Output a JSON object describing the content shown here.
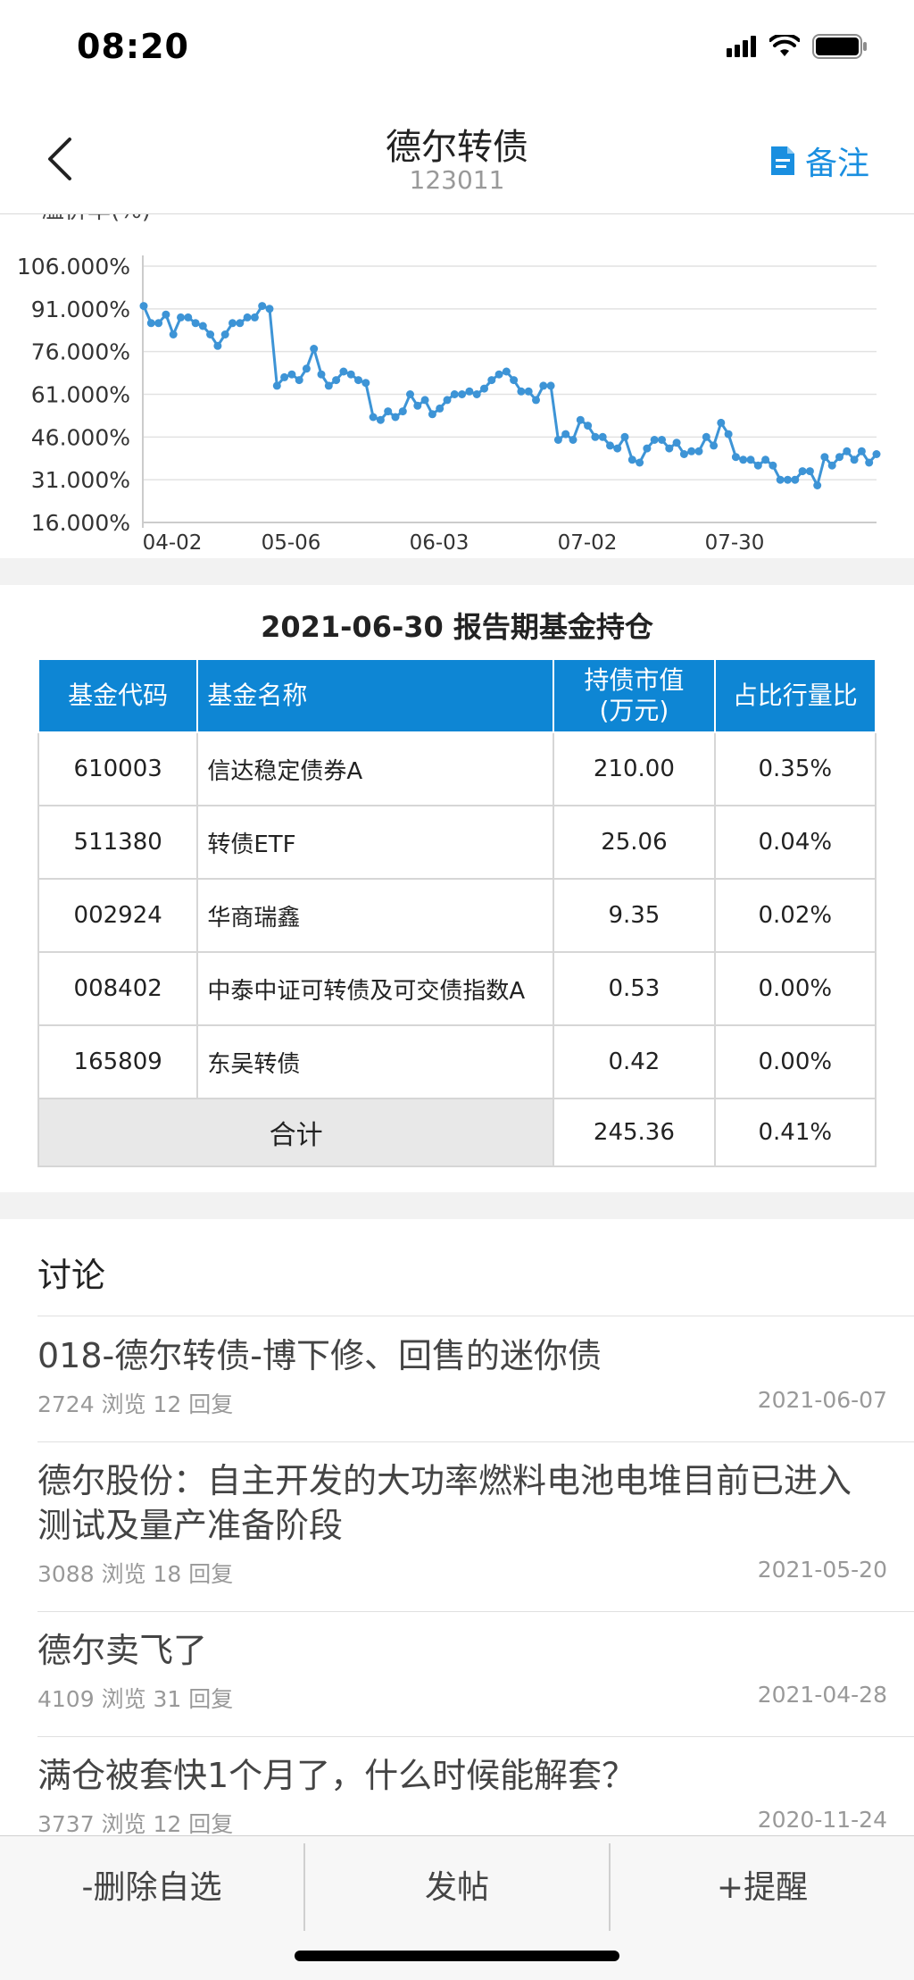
{
  "status_bar": {
    "time": "08:20"
  },
  "nav": {
    "title": "德尔转债",
    "subtitle": "123011",
    "note_label": "备注"
  },
  "chart_data": {
    "type": "line",
    "ylabel": "溢价率(%)",
    "yticks": [
      "106.000%",
      "91.000%",
      "76.000%",
      "61.000%",
      "46.000%",
      "31.000%",
      "16.000%"
    ],
    "ylim": [
      16,
      106
    ],
    "xticks": [
      "04-02",
      "05-06",
      "06-03",
      "07-02",
      "07-30"
    ],
    "series": [
      {
        "values": [
          92,
          86,
          86,
          89,
          82,
          88,
          88,
          86,
          85,
          82,
          78,
          82,
          86,
          86,
          88,
          88,
          92,
          91,
          64,
          67,
          68,
          66,
          70,
          77,
          68,
          64,
          66,
          69,
          68,
          66,
          65,
          53,
          52,
          55,
          53,
          55,
          61,
          57,
          59,
          54,
          56,
          59,
          61,
          61,
          62,
          61,
          63,
          66,
          68,
          69,
          66,
          62,
          62,
          59,
          64,
          64,
          45,
          47,
          45,
          52,
          50,
          46,
          46,
          43,
          42,
          46,
          38,
          37,
          42,
          45,
          45,
          42,
          44,
          40,
          41,
          41,
          46,
          43,
          51,
          47,
          39,
          38,
          38,
          36,
          38,
          36,
          31,
          31,
          31,
          34,
          34,
          29,
          39,
          36,
          39,
          41,
          38,
          41,
          37,
          40
        ],
        "color": "#3d94d6"
      }
    ]
  },
  "holdings": {
    "title": "2021-06-30 报告期基金持仓",
    "headers": {
      "code": "基金代码",
      "name": "基金名称",
      "value_line1": "持债市值",
      "value_line2": "(万元)",
      "ratio": "占比行量比"
    },
    "rows": [
      {
        "code": "610003",
        "name": "信达稳定债券A",
        "value": "210.00",
        "ratio": "0.35%"
      },
      {
        "code": "511380",
        "name": "转债ETF",
        "value": "25.06",
        "ratio": "0.04%"
      },
      {
        "code": "002924",
        "name": "华商瑞鑫",
        "value": "9.35",
        "ratio": "0.02%"
      },
      {
        "code": "008402",
        "name": "中泰中证可转债及可交债指数A",
        "value": "0.53",
        "ratio": "0.00%"
      },
      {
        "code": "165809",
        "name": "东吴转债",
        "value": "0.42",
        "ratio": "0.00%"
      }
    ],
    "total": {
      "label": "合计",
      "value": "245.36",
      "ratio": "0.41%"
    }
  },
  "discussion": {
    "title": "讨论",
    "posts": [
      {
        "title": "018-德尔转债-博下修、回售的迷你债",
        "stats": "2724 浏览 12 回复",
        "date": "2021-06-07"
      },
      {
        "title": "德尔股份：自主开发的大功率燃料电池电堆目前已进入测试及量产准备阶段",
        "stats": "3088 浏览 18 回复",
        "date": "2021-05-20"
      },
      {
        "title": "德尔卖飞了",
        "stats": "4109 浏览 31 回复",
        "date": "2021-04-28"
      },
      {
        "title": "满仓被套快1个月了，什么时候能解套？",
        "stats": "3737 浏览 12 回复",
        "date": "2020-11-24"
      }
    ]
  },
  "bottom_bar": {
    "remove_label": "-删除自选",
    "post_label": "发帖",
    "remind_label": "+提醒"
  }
}
